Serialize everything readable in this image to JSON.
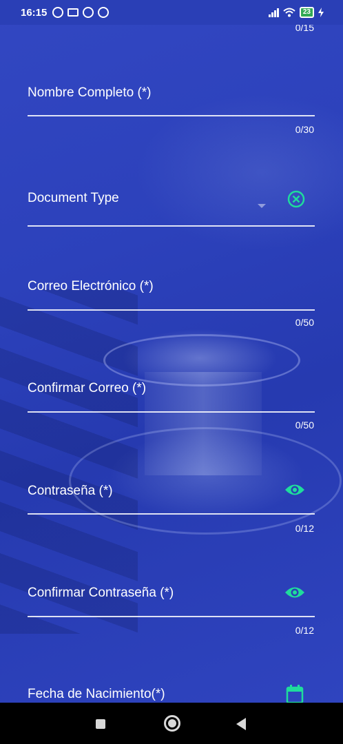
{
  "status_bar": {
    "time": "16:15",
    "battery": "23"
  },
  "form": {
    "top_counter": "0/15",
    "fields": [
      {
        "label": "Nombre Completo (*)",
        "counter": "0/30"
      },
      {
        "label": "Document Type",
        "icon": "close-circle-icon"
      },
      {
        "label": "Correo Electrónico (*)",
        "counter": "0/50"
      },
      {
        "label": "Confirmar Correo (*)",
        "counter": "0/50"
      },
      {
        "label": "Contraseña (*)",
        "counter": "0/12",
        "icon": "eye-icon"
      },
      {
        "label": "Confirmar Contraseña (*)",
        "counter": "0/12",
        "icon": "eye-icon"
      },
      {
        "label": "Fecha de Nacimiento(*)",
        "icon": "calendar-icon"
      }
    ]
  },
  "colors": {
    "accent": "#1fdc9c",
    "background": "#2a3fb6"
  }
}
